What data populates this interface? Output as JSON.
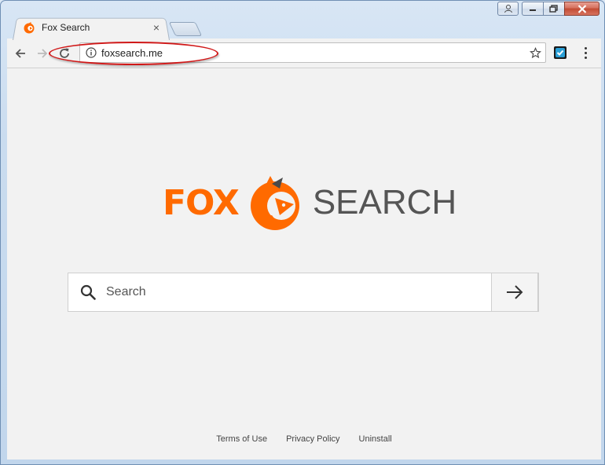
{
  "browser": {
    "tab": {
      "title": "Fox Search",
      "close_glyph": "×"
    },
    "address": {
      "url": "foxsearch.me"
    }
  },
  "page": {
    "logo": {
      "left_text": "FOX",
      "right_text": "SEARCH"
    },
    "search": {
      "placeholder": "Search",
      "value": ""
    },
    "footer_links": [
      "Terms of Use",
      "Privacy Policy",
      "Uninstall"
    ]
  },
  "colors": {
    "brand_orange": "#ff6a00",
    "annotation_red": "#d01818"
  },
  "icons": {
    "back": "arrow-left-icon",
    "forward": "arrow-right-icon",
    "reload": "reload-icon",
    "info": "info-icon",
    "bookmark": "star-icon",
    "extension": "extension-icon",
    "menu": "kebab-menu-icon",
    "search": "magnifier-icon",
    "submit": "arrow-right-icon"
  }
}
